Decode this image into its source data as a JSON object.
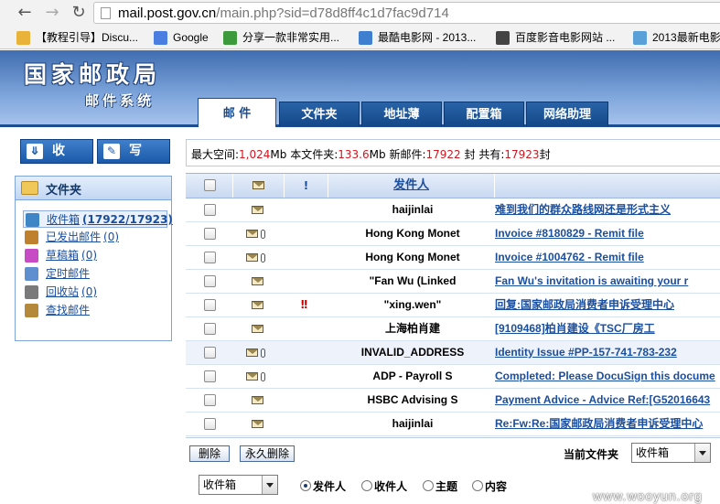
{
  "browser": {
    "url_host": "mail.post.gov.cn",
    "url_path": "/main.php?sid=d78d8ff4c1d7fac9d714",
    "bookmarks": [
      {
        "label": "【教程引导】Discu...",
        "icon": "star-folder-icon",
        "color": "#e9b33a"
      },
      {
        "label": "Google",
        "icon": "google-icon",
        "color": "#4a7ee0"
      },
      {
        "label": "分享一款非常实用...",
        "icon": "leaf-icon",
        "color": "#3c9a3c"
      },
      {
        "label": "最酷电影网 - 2013...",
        "icon": "film-icon",
        "color": "#3f7fcf"
      },
      {
        "label": "百度影音电影网站 ...",
        "icon": "film-reel-icon",
        "color": "#444444"
      },
      {
        "label": "2013最新电影",
        "icon": "movie-icon",
        "color": "#5aa0d8"
      }
    ]
  },
  "header": {
    "title": "国家邮政局",
    "subtitle": "邮件系统",
    "tabs": [
      "邮 件",
      "文件夹",
      "地址薄",
      "配置箱",
      "网络助理"
    ]
  },
  "actions": {
    "receive_label": "收 信",
    "compose_label": "写 信"
  },
  "folders": {
    "title": "文件夹",
    "items": [
      {
        "label": "收件箱",
        "count": "(17922/17923)",
        "icon": "inbox-icon",
        "color": "#3e86c6"
      },
      {
        "label": "已发出邮件",
        "count": "(0)",
        "icon": "sent-mail-icon",
        "color": "#c0812e"
      },
      {
        "label": "草稿箱",
        "count": "(0)",
        "icon": "drafts-icon",
        "color": "#c74bc4"
      },
      {
        "label": "定时邮件",
        "count": "",
        "icon": "scheduled-mail-icon",
        "color": "#5f8fcf"
      },
      {
        "label": "回收站",
        "count": "(0)",
        "icon": "trash-icon",
        "color": "#7a7a7a"
      },
      {
        "label": "查找邮件",
        "count": "",
        "icon": "search-mail-icon",
        "color": "#b5893a"
      }
    ]
  },
  "status": {
    "max_space_label": "最大空间:",
    "max_space_value": "1,024",
    "max_space_unit": "Mb",
    "folder_label": "本文件夹:",
    "folder_value": "133.6",
    "folder_unit": "Mb",
    "new_label": "新邮件:",
    "new_value": "17922",
    "new_unit": "封",
    "total_label": "共有:",
    "total_value": "17923",
    "total_unit": "封"
  },
  "table": {
    "priority_header": "!",
    "sender_header": "发件人",
    "rows": [
      {
        "sender": "haijinlai",
        "subject": "难到我们的群众路线网还是形式主义",
        "attachment": false,
        "priority": ""
      },
      {
        "sender": "Hong Kong Monet",
        "subject": "Invoice #8180829 - Remit file",
        "attachment": true,
        "priority": ""
      },
      {
        "sender": "Hong Kong Monet",
        "subject": "Invoice #1004762 - Remit file",
        "attachment": true,
        "priority": ""
      },
      {
        "sender": "\"Fan Wu (Linked",
        "subject": "Fan Wu's invitation is awaiting your r",
        "attachment": false,
        "priority": ""
      },
      {
        "sender": "\"xing.wen\"",
        "subject": "回复:国家邮政局消费者申诉受理中心",
        "attachment": false,
        "priority": "!!"
      },
      {
        "sender": "上海柏肖建",
        "subject": "[9109468]柏肖建设《TSC厂房工",
        "attachment": false,
        "priority": ""
      },
      {
        "sender": "INVALID_ADDRESS",
        "subject": "Identity Issue #PP-157-741-783-232",
        "attachment": true,
        "priority": ""
      },
      {
        "sender": "ADP - Payroll S",
        "subject": "Completed: Please DocuSign this docume",
        "attachment": true,
        "priority": ""
      },
      {
        "sender": "HSBC Advising S",
        "subject": "Payment Advice - Advice Ref:[G52016643",
        "attachment": false,
        "priority": ""
      },
      {
        "sender": "haijinlai",
        "subject": "Re:Fw:Re:国家邮政局消费者申诉受理中心",
        "attachment": false,
        "priority": ""
      }
    ]
  },
  "bottom": {
    "delete_label": "删除",
    "perm_delete_label": "永久删除",
    "current_folder_label": "当前文件夹",
    "current_folder_value": "收件箱",
    "search_folder_value": "收件箱",
    "search_options": [
      "发件人",
      "收件人",
      "主题",
      "内容"
    ],
    "search_selected": "发件人"
  },
  "watermark": "www.wooyun.org"
}
